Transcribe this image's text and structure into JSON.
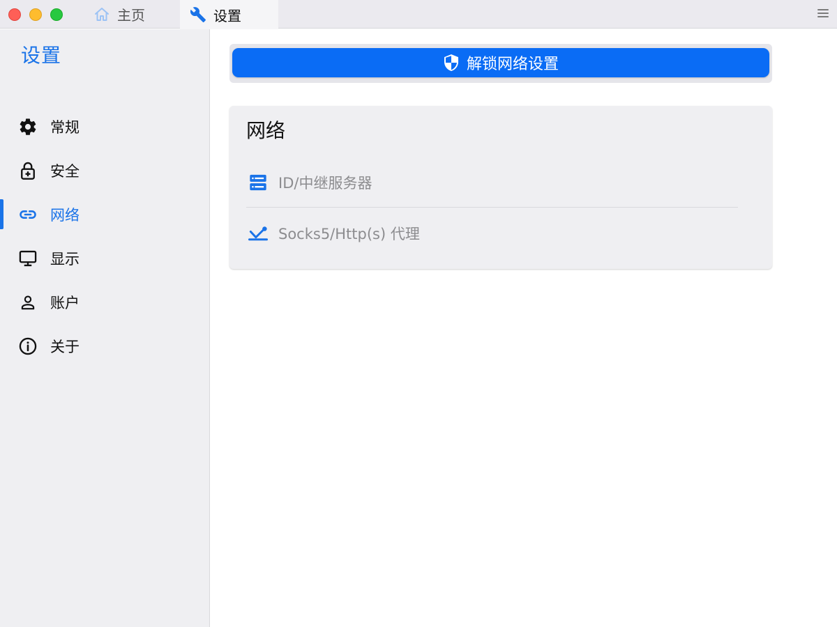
{
  "titlebar": {
    "tabs": [
      {
        "label": "主页",
        "icon": "home-icon"
      },
      {
        "label": "设置",
        "icon": "wrench-icon"
      }
    ],
    "menu_icon": "hamburger-menu-icon"
  },
  "sidebar": {
    "title": "设置",
    "items": [
      {
        "label": "常规",
        "icon": "gear-icon"
      },
      {
        "label": "安全",
        "icon": "lock-icon"
      },
      {
        "label": "网络",
        "icon": "link-icon",
        "active": true
      },
      {
        "label": "显示",
        "icon": "monitor-icon"
      },
      {
        "label": "账户",
        "icon": "person-icon"
      },
      {
        "label": "关于",
        "icon": "info-icon"
      }
    ]
  },
  "main": {
    "unlock_button": {
      "label": "解锁网络设置",
      "icon": "shield-icon"
    },
    "network_card": {
      "title": "网络",
      "rows": [
        {
          "label": "ID/中继服务器",
          "icon": "server-icon"
        },
        {
          "label": "Socks5/Http(s) 代理",
          "icon": "proxy-icon"
        }
      ]
    }
  },
  "colors": {
    "accent": "#1a73e8",
    "button_blue": "#0a6cf5",
    "sidebar_bg": "#efeff2",
    "muted_text": "#8c8c8f"
  }
}
